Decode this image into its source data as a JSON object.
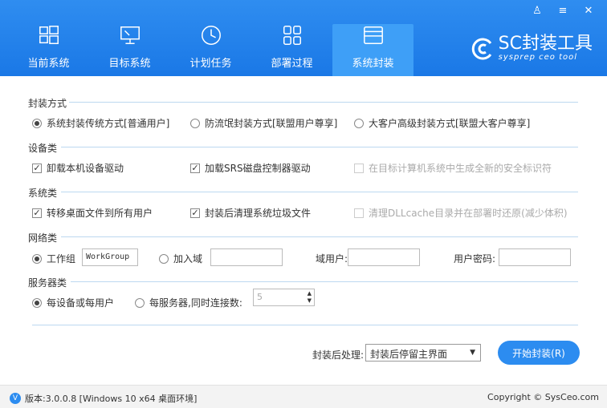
{
  "window_controls": {
    "user": "♙",
    "menu": "≡",
    "close": "✕"
  },
  "tabs": [
    {
      "label": "当前系统",
      "icon": "windows-icon"
    },
    {
      "label": "目标系统",
      "icon": "monitor-icon"
    },
    {
      "label": "计划任务",
      "icon": "clock-icon"
    },
    {
      "label": "部署过程",
      "icon": "grid-icon"
    },
    {
      "label": "系统封装",
      "icon": "package-icon",
      "active": true
    }
  ],
  "brand": {
    "title": "SC封装工具",
    "subtitle": "sysprep ceo tool"
  },
  "sections": {
    "method": {
      "title": "封装方式",
      "options": [
        "系统封装传统方式[普通用户]",
        "防流氓封装方式[联盟用户尊享]",
        "大客户高级封装方式[联盟大客户尊享]"
      ],
      "selected": 0
    },
    "device": {
      "title": "设备类",
      "options": [
        "卸载本机设备驱动",
        "加载SRS磁盘控制器驱动",
        "在目标计算机系统中生成全新的安全标识符"
      ]
    },
    "system": {
      "title": "系统类",
      "options": [
        "转移桌面文件到所有用户",
        "封装后清理系统垃圾文件",
        "清理DLLcache目录并在部署时还原(减少体积)"
      ]
    },
    "network": {
      "title": "网络类",
      "workgroup_label": "工作组",
      "workgroup_value": "WorkGroup",
      "domain_label": "加入域",
      "domain_user_label": "域用户:",
      "domain_password_label": "用户密码:"
    },
    "server": {
      "title": "服务器类",
      "per_device_label": "每设备或每用户",
      "per_server_label": "每服务器,同时连接数:",
      "connections": "5"
    }
  },
  "post": {
    "label": "封装后处理:",
    "selected": "封装后停留主界面",
    "start_button": "开始封装(R)"
  },
  "footer": {
    "version": "版本:3.0.0.8 [Windows 10 x64 桌面环境]",
    "copyright": "Copyright © SysCeo.com"
  }
}
